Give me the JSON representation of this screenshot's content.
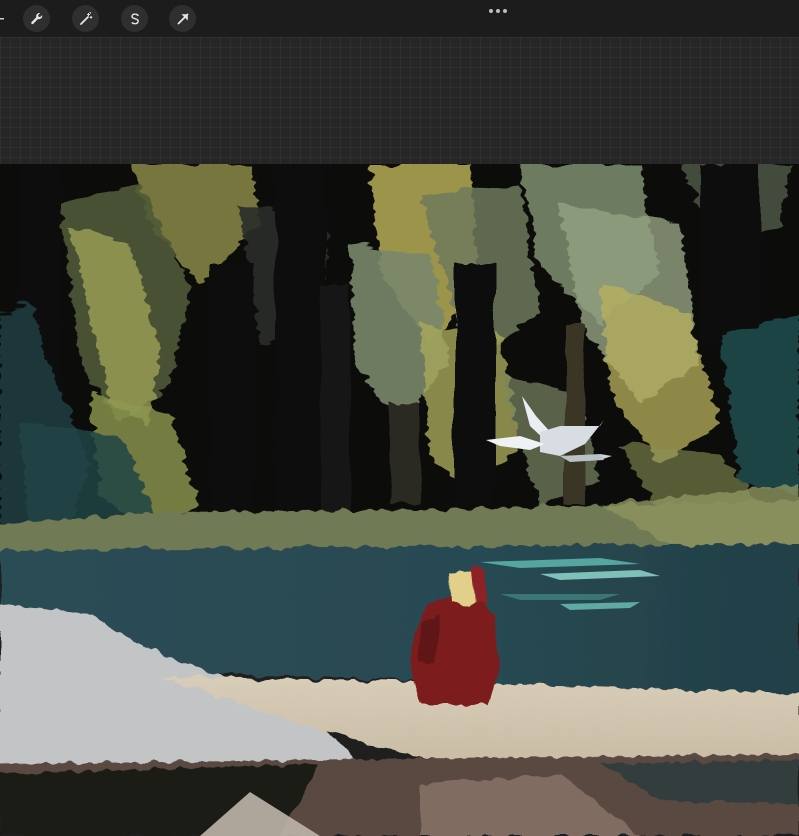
{
  "toolbar": {
    "tools": [
      {
        "id": "actions",
        "icon": "wrench-icon"
      },
      {
        "id": "adjustments",
        "icon": "magic-wand-icon"
      },
      {
        "id": "selection",
        "icon": "selection-s-icon"
      },
      {
        "id": "transform",
        "icon": "arrow-cursor-icon"
      }
    ],
    "more_icon": "more-dots-icon"
  },
  "colors": {
    "toolbar_bg": "#1c1c1c",
    "canvas_bg": "#262626",
    "tool_button_bg": "#2f2f2f",
    "icon_color": "#e6e6e6"
  }
}
